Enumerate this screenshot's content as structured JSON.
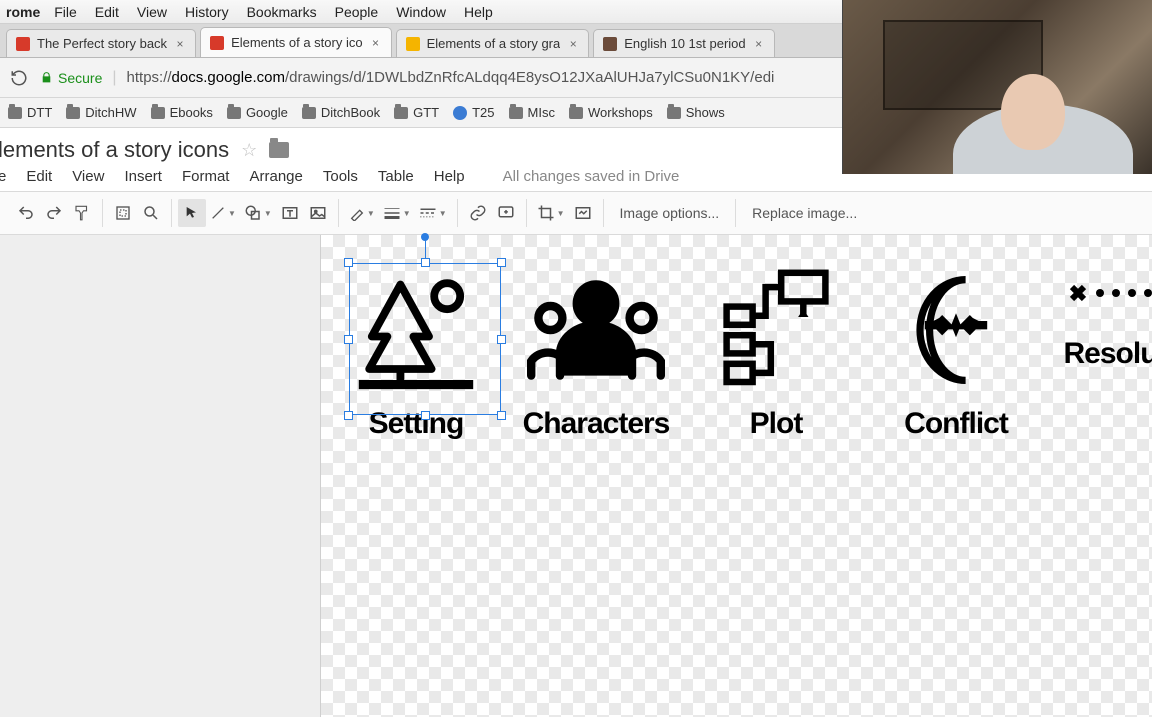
{
  "mac_menu": {
    "app": "rome",
    "items": [
      "File",
      "Edit",
      "View",
      "History",
      "Bookmarks",
      "People",
      "Window",
      "Help"
    ]
  },
  "tabs": [
    {
      "label": "The Perfect story back",
      "active": false,
      "favicon_color": "#d73a2a"
    },
    {
      "label": "Elements of a story ico",
      "active": true,
      "favicon_color": "#d73a2a"
    },
    {
      "label": "Elements of a story gra",
      "active": false,
      "favicon_color": "#f5b400"
    },
    {
      "label": "English 10 1st period",
      "active": false,
      "favicon_color": "#6b4b3a"
    }
  ],
  "address": {
    "secure_label": "Secure",
    "scheme": "https://",
    "host": "docs.google.com",
    "path": "/drawings/d/1DWLbdZnRfcALdqq4E8ysO12JXaAlUHJa7ylCSu0N1KY/edi"
  },
  "bookmarks": [
    {
      "label": "DTT",
      "kind": "folder"
    },
    {
      "label": "DitchHW",
      "kind": "folder"
    },
    {
      "label": "Ebooks",
      "kind": "folder"
    },
    {
      "label": "Google",
      "kind": "folder"
    },
    {
      "label": "DitchBook",
      "kind": "folder"
    },
    {
      "label": "GTT",
      "kind": "folder"
    },
    {
      "label": "T25",
      "kind": "site"
    },
    {
      "label": "MIsc",
      "kind": "folder"
    },
    {
      "label": "Workshops",
      "kind": "folder"
    },
    {
      "label": "Shows",
      "kind": "folder"
    }
  ],
  "doc": {
    "title": "lements of a story icons",
    "menus": [
      "e",
      "Edit",
      "View",
      "Insert",
      "Format",
      "Arrange",
      "Tools",
      "Table",
      "Help"
    ],
    "save_status": "All changes saved in Drive"
  },
  "toolbar": {
    "image_options": "Image options...",
    "replace_image": "Replace image..."
  },
  "story": {
    "items": [
      {
        "key": "setting",
        "label": "Setting",
        "selected": true
      },
      {
        "key": "characters",
        "label": "Characters",
        "selected": false
      },
      {
        "key": "plot",
        "label": "Plot",
        "selected": false
      },
      {
        "key": "conflict",
        "label": "Conflict",
        "selected": false
      },
      {
        "key": "resolution",
        "label": "Resolution",
        "selected": false
      }
    ]
  }
}
